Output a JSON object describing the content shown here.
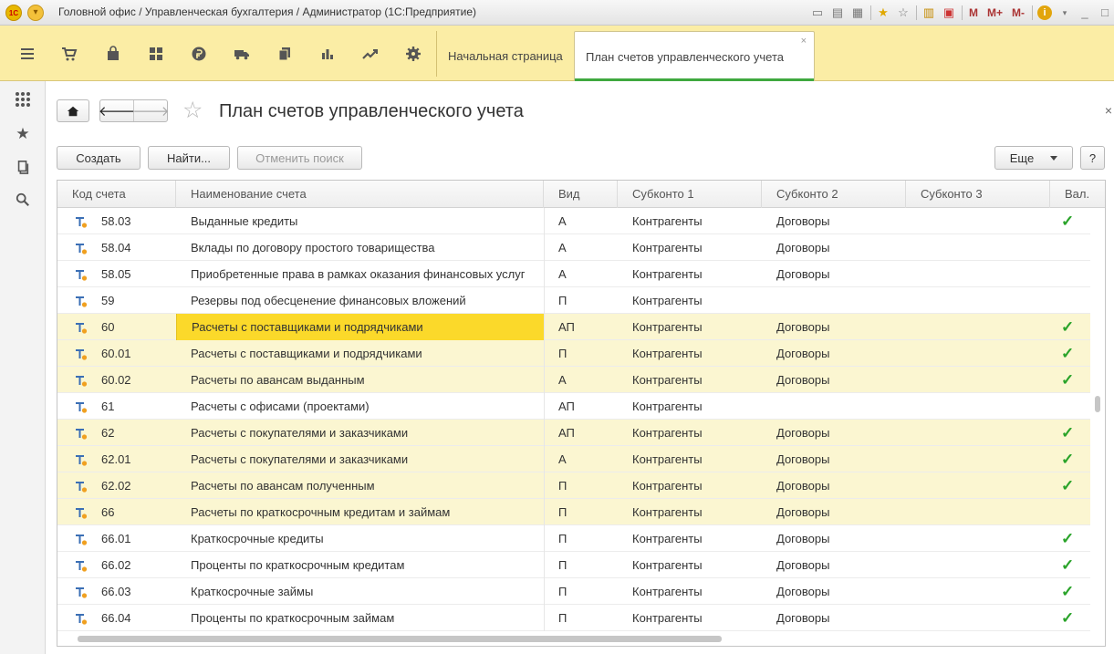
{
  "window": {
    "title": "Головной офис / Управленческая бухгалтерия / Администратор  (1С:Предприятие)",
    "logo_text": "1С",
    "m_labels": [
      "M",
      "M+",
      "M-"
    ]
  },
  "tabs": {
    "home": "Начальная страница",
    "active": "План счетов управленческого учета",
    "close": "×"
  },
  "sections": [
    {
      "name": "menu-icon"
    },
    {
      "name": "cart-icon"
    },
    {
      "name": "bag-icon"
    },
    {
      "name": "grid-icon"
    },
    {
      "name": "ruble-icon"
    },
    {
      "name": "truck-icon"
    },
    {
      "name": "copy-icon"
    },
    {
      "name": "bar-chart-icon"
    },
    {
      "name": "trend-icon"
    },
    {
      "name": "gear-icon"
    }
  ],
  "page": {
    "title": "План счетов управленческого учета",
    "close": "×"
  },
  "buttons": {
    "create": "Создать",
    "find": "Найти...",
    "cancel_search": "Отменить поиск",
    "more": "Еще",
    "help": "?"
  },
  "table": {
    "headers": {
      "code": "Код счета",
      "name": "Наименование счета",
      "kind": "Вид",
      "sub1": "Субконто 1",
      "sub2": "Субконто 2",
      "sub3": "Субконто 3",
      "cur": "Вал."
    },
    "rows": [
      {
        "code": "58.03",
        "name": "Выданные кредиты",
        "kind": "А",
        "sub1": "Контрагенты",
        "sub2": "Договоры",
        "sub3": "",
        "cur": "✓",
        "hl": false
      },
      {
        "code": "58.04",
        "name": "Вклады по договору простого товарищества",
        "kind": "А",
        "sub1": "Контрагенты",
        "sub2": "Договоры",
        "sub3": "",
        "cur": "",
        "hl": false
      },
      {
        "code": "58.05",
        "name": "Приобретенные права в рамках оказания финансовых услуг",
        "kind": "А",
        "sub1": "Контрагенты",
        "sub2": "Договоры",
        "sub3": "",
        "cur": "",
        "hl": false
      },
      {
        "code": "59",
        "name": "Резервы под обесценение финансовых вложений",
        "kind": "П",
        "sub1": "Контрагенты",
        "sub2": "",
        "sub3": "",
        "cur": "",
        "hl": false
      },
      {
        "code": "60",
        "name": "Расчеты с поставщиками и подрядчиками",
        "kind": "АП",
        "sub1": "Контрагенты",
        "sub2": "Договоры",
        "sub3": "",
        "cur": "✓",
        "hl": true,
        "selected": true
      },
      {
        "code": "60.01",
        "name": "Расчеты с поставщиками и подрядчиками",
        "kind": "П",
        "sub1": "Контрагенты",
        "sub2": "Договоры",
        "sub3": "",
        "cur": "✓",
        "hl": true
      },
      {
        "code": "60.02",
        "name": "Расчеты по авансам выданным",
        "kind": "А",
        "sub1": "Контрагенты",
        "sub2": "Договоры",
        "sub3": "",
        "cur": "✓",
        "hl": true
      },
      {
        "code": "61",
        "name": "Расчеты с офисами (проектами)",
        "kind": "АП",
        "sub1": "Контрагенты",
        "sub2": "",
        "sub3": "",
        "cur": "",
        "hl": false
      },
      {
        "code": "62",
        "name": "Расчеты с покупателями и заказчиками",
        "kind": "АП",
        "sub1": "Контрагенты",
        "sub2": "Договоры",
        "sub3": "",
        "cur": "✓",
        "hl": true
      },
      {
        "code": "62.01",
        "name": "Расчеты с покупателями и заказчиками",
        "kind": "А",
        "sub1": "Контрагенты",
        "sub2": "Договоры",
        "sub3": "",
        "cur": "✓",
        "hl": true
      },
      {
        "code": "62.02",
        "name": "Расчеты по авансам полученным",
        "kind": "П",
        "sub1": "Контрагенты",
        "sub2": "Договоры",
        "sub3": "",
        "cur": "✓",
        "hl": true
      },
      {
        "code": "66",
        "name": "Расчеты по краткосрочным кредитам и займам",
        "kind": "П",
        "sub1": "Контрагенты",
        "sub2": "Договоры",
        "sub3": "",
        "cur": "",
        "hl": true
      },
      {
        "code": "66.01",
        "name": "Краткосрочные кредиты",
        "kind": "П",
        "sub1": "Контрагенты",
        "sub2": "Договоры",
        "sub3": "",
        "cur": "✓",
        "hl": false
      },
      {
        "code": "66.02",
        "name": "Проценты по краткосрочным кредитам",
        "kind": "П",
        "sub1": "Контрагенты",
        "sub2": "Договоры",
        "sub3": "",
        "cur": "✓",
        "hl": false
      },
      {
        "code": "66.03",
        "name": "Краткосрочные займы",
        "kind": "П",
        "sub1": "Контрагенты",
        "sub2": "Договоры",
        "sub3": "",
        "cur": "✓",
        "hl": false
      },
      {
        "code": "66.04",
        "name": "Проценты по краткосрочным займам",
        "kind": "П",
        "sub1": "Контрагенты",
        "sub2": "Договоры",
        "sub3": "",
        "cur": "✓",
        "hl": false
      }
    ]
  },
  "colors": {
    "toolbar": "#fbeda5",
    "row_highlight": "#fbf6d1",
    "selected_cell": "#fbd92a",
    "check": "#29a329",
    "active_tab_underline": "#3fa83f"
  }
}
